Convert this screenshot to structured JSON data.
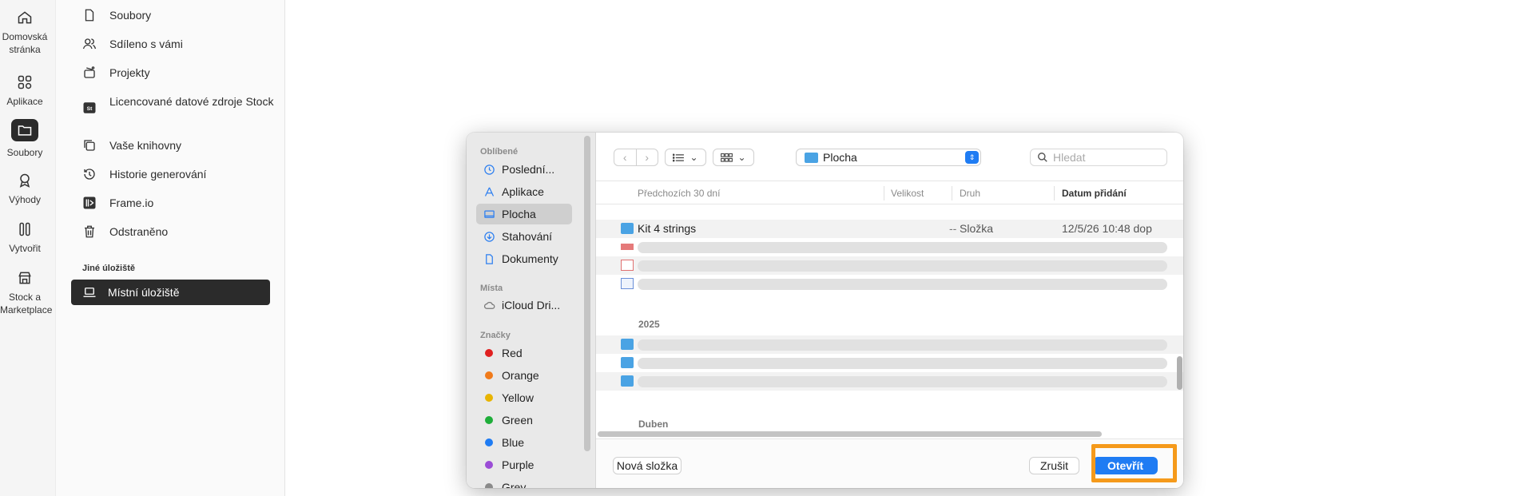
{
  "rail": {
    "items": [
      {
        "label": "Domovská stránka",
        "icon": "home-icon"
      },
      {
        "label": "Aplikace",
        "icon": "apps-icon"
      },
      {
        "label": "Soubory",
        "icon": "folder-icon"
      },
      {
        "label": "Výhody",
        "icon": "badge-icon"
      },
      {
        "label": "Vytvořit",
        "icon": "create-icon"
      },
      {
        "label": "Stock a Marketplace",
        "icon": "store-icon"
      }
    ]
  },
  "files_panel": {
    "items": [
      {
        "label": "Soubory",
        "icon": "file-icon"
      },
      {
        "label": "Sdíleno s vámi",
        "icon": "people-icon"
      },
      {
        "label": "Projekty",
        "icon": "projects-icon"
      },
      {
        "label": "Licencované datové zdroje Stock",
        "icon": "stock-icon"
      },
      {
        "label": "Vaše knihovny",
        "icon": "library-icon"
      },
      {
        "label": "Historie generování",
        "icon": "history-icon"
      },
      {
        "label": "Frame.io",
        "icon": "frameio-icon"
      },
      {
        "label": "Odstraněno",
        "icon": "trash-icon"
      }
    ],
    "section_label": "Jiné úložiště",
    "local_storage": "Místní úložiště"
  },
  "dialog": {
    "sidebar": {
      "favorites_head": "Oblíbené",
      "favorites": [
        "Poslední...",
        "Aplikace",
        "Plocha",
        "Stahování",
        "Dokumenty"
      ],
      "places_head": "Místa",
      "places": [
        "iCloud Dri..."
      ],
      "tags_head": "Značky",
      "tags": [
        {
          "label": "Red",
          "color": "#e02020"
        },
        {
          "label": "Orange",
          "color": "#f07a1a"
        },
        {
          "label": "Yellow",
          "color": "#e8b400"
        },
        {
          "label": "Green",
          "color": "#1fae3a"
        },
        {
          "label": "Blue",
          "color": "#1f7cf3"
        },
        {
          "label": "Purple",
          "color": "#9b4dd6"
        },
        {
          "label": "Grey",
          "color": "#8a8a8a"
        }
      ]
    },
    "location": "Plocha",
    "search_placeholder": "Hledat",
    "columns": {
      "name": "Předchozích 30 dní",
      "size": "Velikost",
      "kind": "Druh",
      "date": "Datum přidání"
    },
    "first_row": {
      "name": "Kit 4 strings",
      "size": "--",
      "kind": "Složka",
      "date": "12/5/26 10:48 dop"
    },
    "groups": [
      "2025",
      "Duben"
    ],
    "new_folder": "Nová složka",
    "cancel": "Zrušit",
    "open": "Otevřít",
    "accent": "#1f7cf3",
    "highlight": "#f59a1b"
  }
}
